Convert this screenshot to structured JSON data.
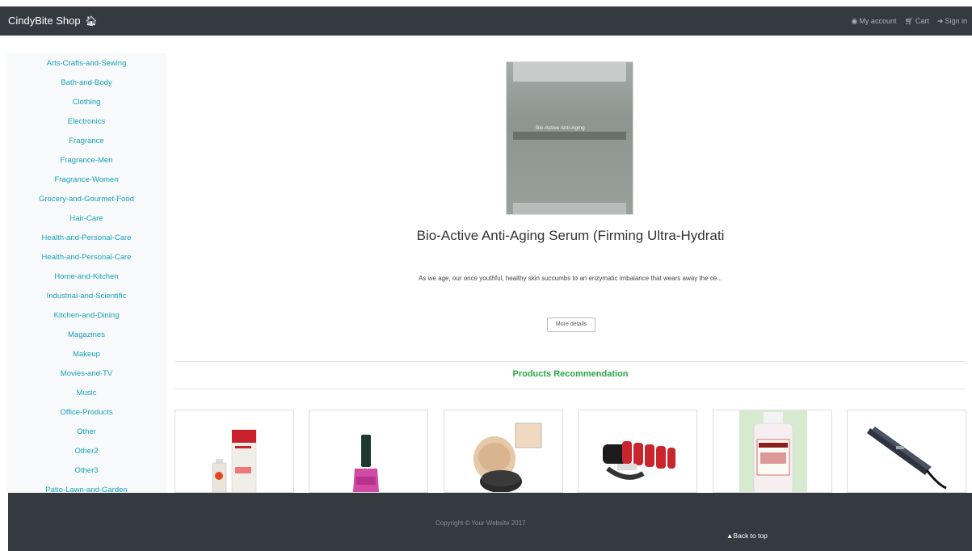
{
  "navbar": {
    "brand": "CindyBite Shop",
    "links": [
      {
        "label": "My account",
        "icon": "user-circle-icon"
      },
      {
        "label": "Cart",
        "icon": "cart-icon"
      },
      {
        "label": "Sign in",
        "icon": "sign-in-icon"
      }
    ]
  },
  "sidebar": {
    "categories": [
      "Arts-Crafts-and-Sewing",
      "Bath-and-Body",
      "Clothing",
      "Electronics",
      "Fragrance",
      "Fragrance-Men",
      "Fragrance-Women",
      "Grocery-and-Gourmet-Food",
      "Hair-Care",
      "Health-and-Personal-Care",
      "Health-and-Personal-Care",
      "Home-and-Kitchen",
      "Industrial-and-Scientific",
      "Kitchen-and-Dining",
      "Magazines",
      "Makeup",
      "Movies-and-TV",
      "Music",
      "Office-Products",
      "Other",
      "Other2",
      "Other3",
      "Patio-Lawn-and-Garden"
    ]
  },
  "product": {
    "image_text": "Bio-Active Anti-Aging",
    "title": "Bio-Active Anti-Aging Serum (Firming Ultra-Hydrati",
    "description": "As we age, our once youthful, healthy skin succumbs to an enzymatic imbalance that wears away the ce...",
    "more_label": "More details"
  },
  "recommendations": {
    "heading": "Products Recommendation",
    "items": [
      {
        "icon": "nail-treatment-product-icon"
      },
      {
        "icon": "nail-polish-product-icon"
      },
      {
        "icon": "mineral-powder-product-icon"
      },
      {
        "icon": "hair-rollers-product-icon"
      },
      {
        "icon": "witch-hazel-toner-product-icon"
      },
      {
        "icon": "hair-straightener-product-icon"
      }
    ]
  },
  "footer": {
    "copyright": "Copyright © Your Website 2017",
    "back_to_top": "Back to top"
  },
  "colors": {
    "navbar_bg": "#343a40",
    "link": "#17a2b8",
    "heading_green": "#28a745"
  }
}
